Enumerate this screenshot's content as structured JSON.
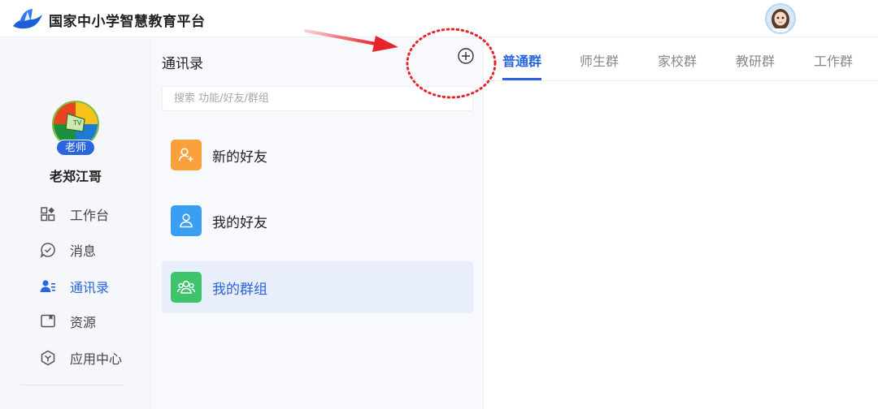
{
  "app": {
    "brand": "国家中小学智慧教育平台"
  },
  "profile": {
    "role": "老师",
    "name": "老郑江哥",
    "avatar_icon": "tv-logo-avatar",
    "user_avatar_icon": "cartoon-girl-avatar"
  },
  "nav": {
    "items": [
      {
        "label": "工作台",
        "icon": "grid-icon",
        "active": false
      },
      {
        "label": "消息",
        "icon": "chat-check-icon",
        "active": false
      },
      {
        "label": "通讯录",
        "icon": "contacts-icon",
        "active": true
      },
      {
        "label": "资源",
        "icon": "resource-icon",
        "active": false
      },
      {
        "label": "应用中心",
        "icon": "app-center-icon",
        "active": false
      }
    ]
  },
  "contacts": {
    "title": "通讯录",
    "search_placeholder": "搜索 功能/好友/群组",
    "items": [
      {
        "label": "新的好友",
        "icon": "add-friend-icon",
        "color": "#f9a23b",
        "active": false
      },
      {
        "label": "我的好友",
        "icon": "friend-icon",
        "color": "#3a9ef2",
        "active": false
      },
      {
        "label": "我的群组",
        "icon": "group-icon",
        "color": "#3ec46d",
        "active": true
      }
    ]
  },
  "tabs": [
    {
      "label": "普通群",
      "active": true
    },
    {
      "label": "师生群",
      "active": false
    },
    {
      "label": "家校群",
      "active": false
    },
    {
      "label": "教研群",
      "active": false
    },
    {
      "label": "工作群",
      "active": false
    }
  ],
  "colors": {
    "accent": "#2a64e0",
    "annotation": "#e8232a"
  }
}
